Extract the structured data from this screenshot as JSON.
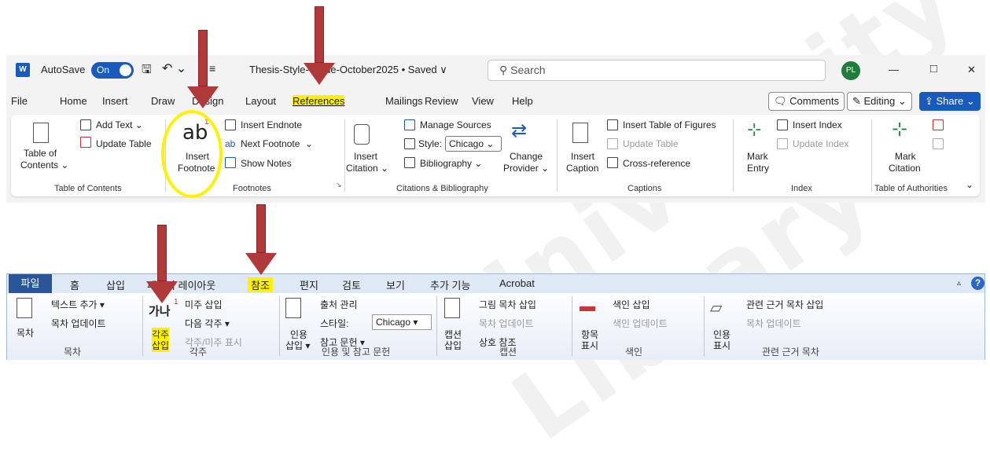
{
  "word": {
    "app_icon": "W",
    "autosave_label": "AutoSave",
    "toggle_label": "On",
    "doc_title": "Thesis-Style-Guide-October2025 • Saved ∨",
    "search_placeholder": "Search",
    "avatar": "PL",
    "window": {
      "minimize": "—",
      "maximize": "□",
      "close": "✕"
    },
    "menu": [
      "File",
      "Home",
      "Insert",
      "Draw",
      "Design",
      "Layout",
      "References",
      "Mailings",
      "Review",
      "View",
      "Help"
    ],
    "comments_label": "Comments",
    "editing_label": "Editing ⌄",
    "share_label": "Share ⌄",
    "ribbon": {
      "toc": {
        "big": "Table of\nContents ⌄",
        "big1": "Table of",
        "big2": "Contents ⌄",
        "add_text": "Add Text ⌄",
        "update_table": "Update Table",
        "group": "Table of Contents"
      },
      "footnotes": {
        "ab": "ab",
        "sup": "1",
        "insert1": "Insert",
        "insert2": "Footnote",
        "insert_endnote": "Insert Endnote",
        "next_footnote": "Next Footnote",
        "show_notes": "Show Notes",
        "group": "Footnotes"
      },
      "citations": {
        "insert1": "Insert",
        "insert2": "Citation ⌄",
        "manage_sources": "Manage Sources",
        "style_label": "Style:",
        "style_value": "Chicago",
        "bibliography": "Bibliography ⌄",
        "change1": "Change",
        "change2": "Provider ⌄",
        "group": "Citations & Bibliography"
      },
      "captions": {
        "insert1": "Insert",
        "insert2": "Caption",
        "insert_tof": "Insert Table of Figures",
        "update_table": "Update Table",
        "cross_ref": "Cross-reference",
        "group": "Captions"
      },
      "index": {
        "mark1": "Mark",
        "mark2": "Entry",
        "insert_index": "Insert Index",
        "update_index": "Update Index",
        "group": "Index"
      },
      "authorities": {
        "mark1": "Mark",
        "mark2": "Citation",
        "group": "Table of Authorities"
      }
    }
  },
  "korean": {
    "tabs": [
      "파일",
      "홈",
      "삽입",
      "페이지 레이아웃",
      "참조",
      "편지",
      "검토",
      "보기",
      "추가 기능",
      "Acrobat"
    ],
    "toc": {
      "big": "목차",
      "add_text": "텍스트 추가 ▾",
      "update": "목차 업데이트",
      "group": "목차"
    },
    "foot": {
      "gana": "가나",
      "sup": "1",
      "insert1": "각주",
      "insert2": "삽입",
      "endnote": "미주 삽입",
      "next": "다음 각주 ▾",
      "show": "각주/미주 표시",
      "group": "각주"
    },
    "cite": {
      "insert1": "인용",
      "insert2": "삽입 ▾",
      "manage": "출처 관리",
      "style_label": "스타일:",
      "style_value": "Chicago",
      "bib": "참고 문헌 ▾",
      "group": "인용 및 참고 문헌"
    },
    "caption": {
      "insert1": "캡션",
      "insert2": "삽입",
      "tof": "그림 목차 삽입",
      "update": "목차 업데이트",
      "cross": "상호 참조",
      "group": "캡션"
    },
    "index": {
      "mark1": "항목",
      "mark2": "표시",
      "insert": "색인 삽입",
      "update": "색인 업데이트",
      "group": "색인"
    },
    "auth": {
      "mark1": "인용",
      "mark2": "표시",
      "insert": "관련 근거 목차 삽입",
      "update": "목차 업데이트",
      "group": "관련 근거 목차"
    }
  },
  "colors": {
    "accent": "#185abd",
    "highlight": "#fff200",
    "arrow": "#b03a3a",
    "kor_file": "#2a5699"
  }
}
